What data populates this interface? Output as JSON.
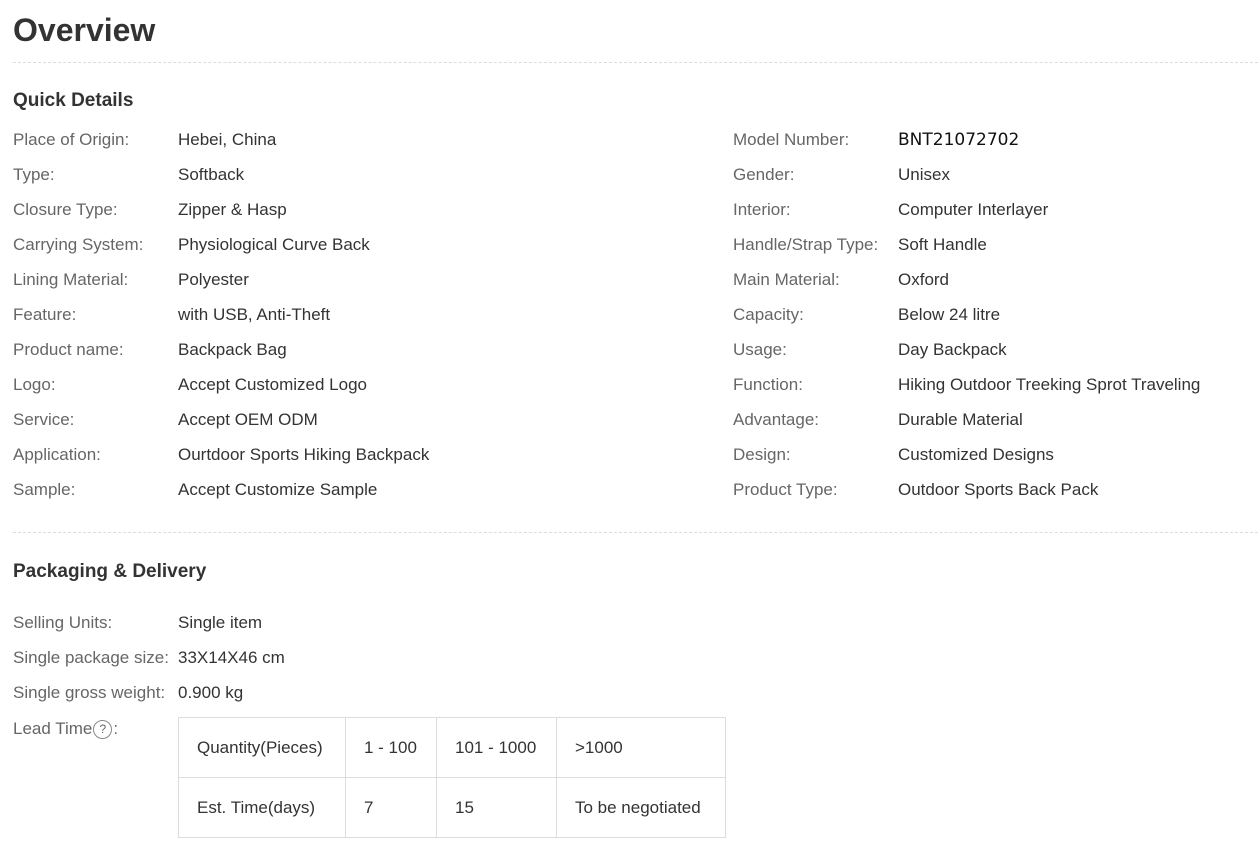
{
  "page": {
    "title": "Overview"
  },
  "quick_details": {
    "title": "Quick Details",
    "rows": [
      {
        "left_label": "Place of Origin:",
        "left_value": "Hebei, China",
        "right_label": "Model Number:",
        "right_value": "BNT21072702"
      },
      {
        "left_label": "Type:",
        "left_value": "Softback",
        "right_label": "Gender:",
        "right_value": "Unisex"
      },
      {
        "left_label": "Closure Type:",
        "left_value": "Zipper & Hasp",
        "right_label": "Interior:",
        "right_value": "Computer Interlayer"
      },
      {
        "left_label": "Carrying System:",
        "left_value": "Physiological Curve Back",
        "right_label": "Handle/Strap Type:",
        "right_value": "Soft Handle"
      },
      {
        "left_label": "Lining Material:",
        "left_value": "Polyester",
        "right_label": "Main Material:",
        "right_value": "Oxford"
      },
      {
        "left_label": "Feature:",
        "left_value": "with USB, Anti-Theft",
        "right_label": "Capacity:",
        "right_value": "Below 24 litre"
      },
      {
        "left_label": "Product name:",
        "left_value": "Backpack Bag",
        "right_label": "Usage:",
        "right_value": "Day Backpack"
      },
      {
        "left_label": "Logo:",
        "left_value": "Accept Customized Logo",
        "right_label": "Function:",
        "right_value": "Hiking Outdoor Treeking Sprot Traveling"
      },
      {
        "left_label": "Service:",
        "left_value": "Accept OEM ODM",
        "right_label": "Advantage:",
        "right_value": "Durable Material"
      },
      {
        "left_label": "Application:",
        "left_value": "Ourtdoor Sports Hiking Backpack",
        "right_label": "Design:",
        "right_value": "Customized Designs"
      },
      {
        "left_label": "Sample:",
        "left_value": "Accept Customize Sample",
        "right_label": "Product Type:",
        "right_value": "Outdoor Sports Back Pack"
      }
    ]
  },
  "packaging": {
    "title": "Packaging & Delivery",
    "rows": [
      {
        "label": "Selling Units:",
        "value": "Single item"
      },
      {
        "label": "Single package size:",
        "value": "33X14X46 cm"
      },
      {
        "label": "Single gross weight:",
        "value": "0.900 kg"
      }
    ],
    "lead_time": {
      "label": "Lead Time",
      "label_suffix": ":",
      "help_icon": "question-circle-icon",
      "help_glyph": "?",
      "table": [
        [
          "Quantity(Pieces)",
          "1 - 100",
          "101 - 1000",
          ">1000"
        ],
        [
          "Est. Time(days)",
          "7",
          "15",
          "To be negotiated"
        ]
      ]
    }
  },
  "colors": {
    "text_primary": "#333333",
    "text_label": "#666666",
    "divider": "#dcdcdc",
    "background": "#ffffff"
  }
}
